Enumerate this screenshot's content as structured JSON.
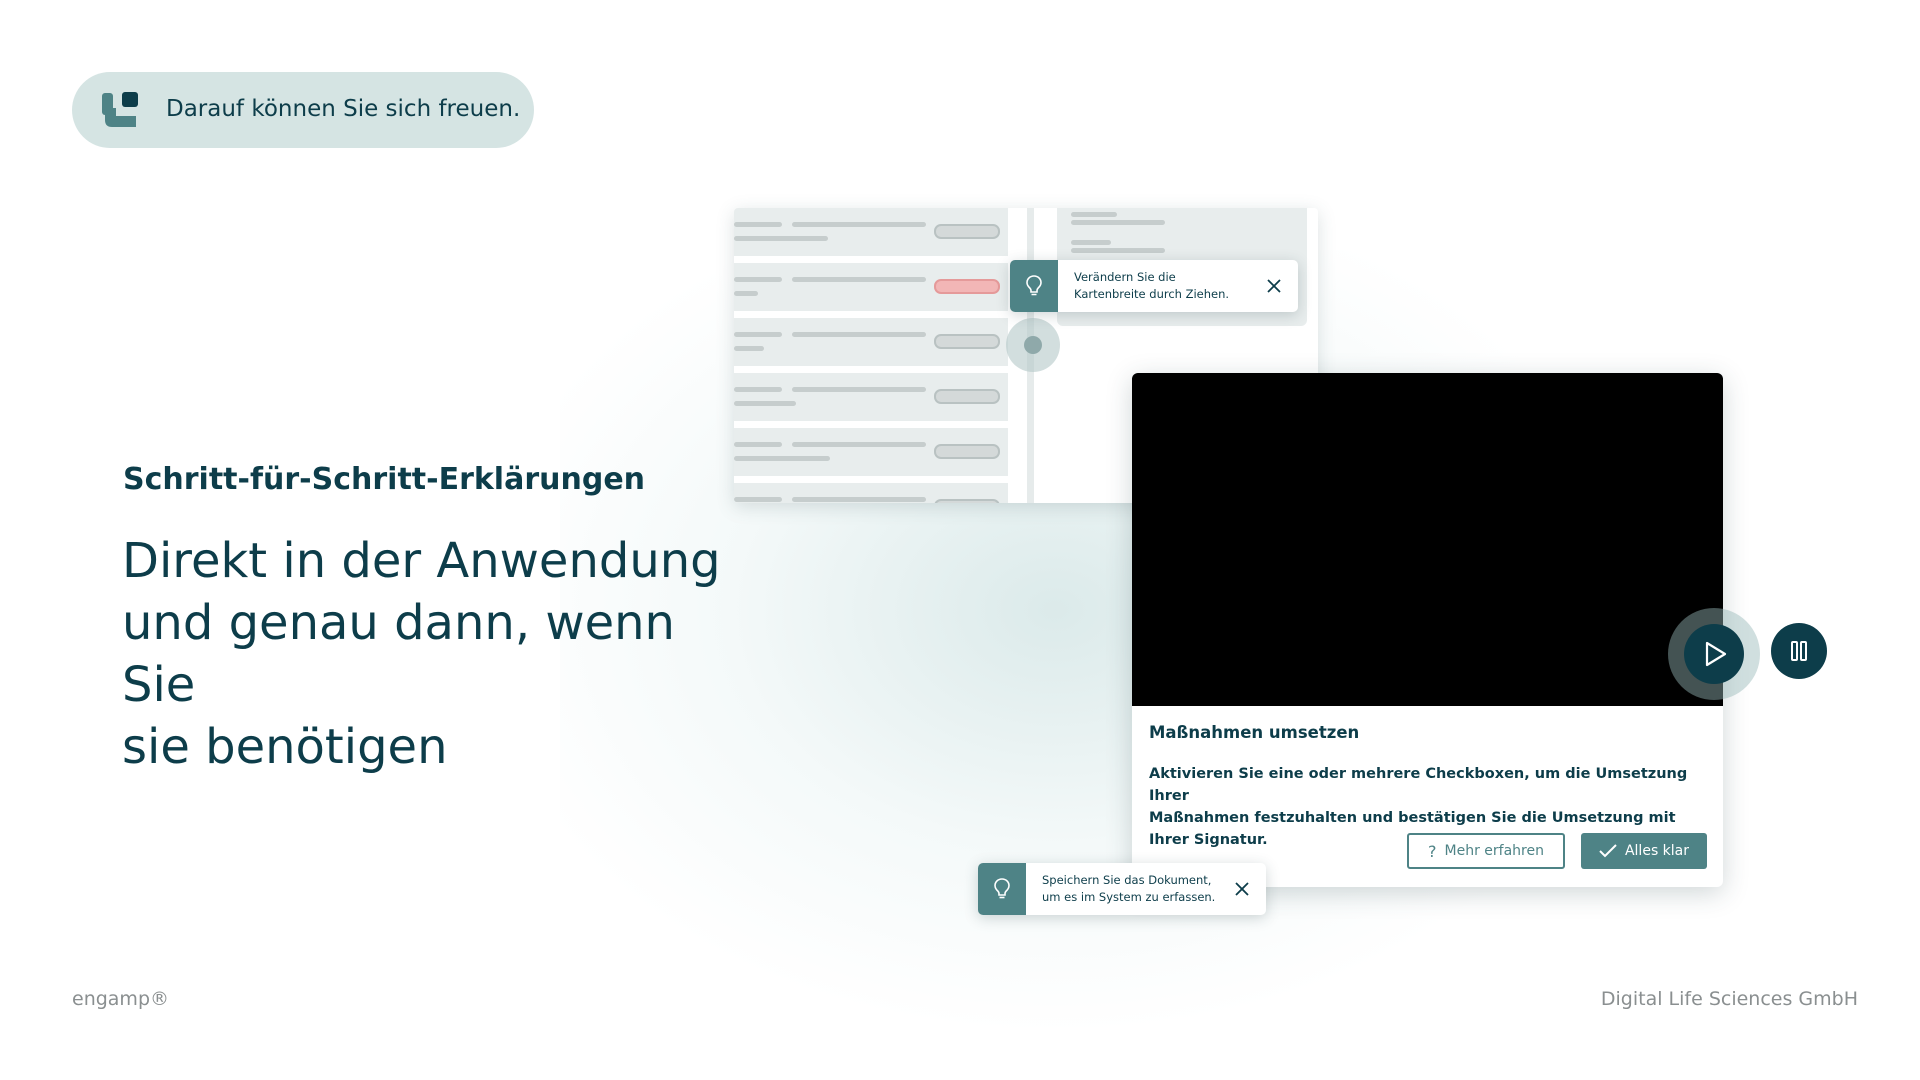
{
  "badge": {
    "icon": "engamp-logo-icon",
    "text": "Darauf können Sie sich freuen."
  },
  "intro": {
    "subtitle": "Schritt-für-Schritt-Erklärungen",
    "headline_lines": [
      "Direkt in der Anwendung",
      "und genau dann, wenn Sie",
      "sie benötigen"
    ]
  },
  "tooltip_resize": {
    "icon": "lightbulb-icon",
    "line1": "Verändern Sie die",
    "line2": "Kartenbreite durch Ziehen.",
    "close_icon": "close-icon"
  },
  "tooltip_save": {
    "icon": "lightbulb-icon",
    "line1": "Speichern Sie das Dokument,",
    "line2": "um es im System zu erfassen.",
    "close_icon": "close-icon"
  },
  "video_card": {
    "title": "Maßnahmen umsetzen",
    "body_line1": "Aktivieren Sie eine oder mehrere Checkboxen, um die Umsetzung Ihrer",
    "body_line2": "Maßnahmen festzuhalten und bestätigen Sie die Umsetzung mit Ihrer Signatur.",
    "secondary_button": "Mehr erfahren",
    "primary_button": "Alles klar"
  },
  "player": {
    "play_icon": "play-icon",
    "pause_icon": "pause-icon"
  },
  "footer": {
    "brand": "engamp®",
    "company": "Digital Life Sciences GmbH"
  },
  "colors": {
    "primary_dark": "#0d3d4a",
    "accent_teal": "#4e8386",
    "badge_bg": "#d5e4e3",
    "alert_red": "#f2b6b6"
  }
}
